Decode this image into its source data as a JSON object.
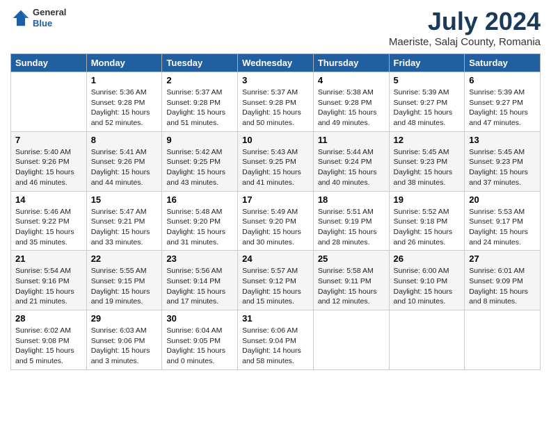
{
  "header": {
    "logo": {
      "line1": "General",
      "line2": "Blue"
    },
    "title": "July 2024",
    "location": "Maeriste, Salaj County, Romania"
  },
  "weekdays": [
    "Sunday",
    "Monday",
    "Tuesday",
    "Wednesday",
    "Thursday",
    "Friday",
    "Saturday"
  ],
  "weeks": [
    [
      {
        "day": "",
        "info": ""
      },
      {
        "day": "1",
        "info": "Sunrise: 5:36 AM\nSunset: 9:28 PM\nDaylight: 15 hours\nand 52 minutes."
      },
      {
        "day": "2",
        "info": "Sunrise: 5:37 AM\nSunset: 9:28 PM\nDaylight: 15 hours\nand 51 minutes."
      },
      {
        "day": "3",
        "info": "Sunrise: 5:37 AM\nSunset: 9:28 PM\nDaylight: 15 hours\nand 50 minutes."
      },
      {
        "day": "4",
        "info": "Sunrise: 5:38 AM\nSunset: 9:28 PM\nDaylight: 15 hours\nand 49 minutes."
      },
      {
        "day": "5",
        "info": "Sunrise: 5:39 AM\nSunset: 9:27 PM\nDaylight: 15 hours\nand 48 minutes."
      },
      {
        "day": "6",
        "info": "Sunrise: 5:39 AM\nSunset: 9:27 PM\nDaylight: 15 hours\nand 47 minutes."
      }
    ],
    [
      {
        "day": "7",
        "info": "Sunrise: 5:40 AM\nSunset: 9:26 PM\nDaylight: 15 hours\nand 46 minutes."
      },
      {
        "day": "8",
        "info": "Sunrise: 5:41 AM\nSunset: 9:26 PM\nDaylight: 15 hours\nand 44 minutes."
      },
      {
        "day": "9",
        "info": "Sunrise: 5:42 AM\nSunset: 9:25 PM\nDaylight: 15 hours\nand 43 minutes."
      },
      {
        "day": "10",
        "info": "Sunrise: 5:43 AM\nSunset: 9:25 PM\nDaylight: 15 hours\nand 41 minutes."
      },
      {
        "day": "11",
        "info": "Sunrise: 5:44 AM\nSunset: 9:24 PM\nDaylight: 15 hours\nand 40 minutes."
      },
      {
        "day": "12",
        "info": "Sunrise: 5:45 AM\nSunset: 9:23 PM\nDaylight: 15 hours\nand 38 minutes."
      },
      {
        "day": "13",
        "info": "Sunrise: 5:45 AM\nSunset: 9:23 PM\nDaylight: 15 hours\nand 37 minutes."
      }
    ],
    [
      {
        "day": "14",
        "info": "Sunrise: 5:46 AM\nSunset: 9:22 PM\nDaylight: 15 hours\nand 35 minutes."
      },
      {
        "day": "15",
        "info": "Sunrise: 5:47 AM\nSunset: 9:21 PM\nDaylight: 15 hours\nand 33 minutes."
      },
      {
        "day": "16",
        "info": "Sunrise: 5:48 AM\nSunset: 9:20 PM\nDaylight: 15 hours\nand 31 minutes."
      },
      {
        "day": "17",
        "info": "Sunrise: 5:49 AM\nSunset: 9:20 PM\nDaylight: 15 hours\nand 30 minutes."
      },
      {
        "day": "18",
        "info": "Sunrise: 5:51 AM\nSunset: 9:19 PM\nDaylight: 15 hours\nand 28 minutes."
      },
      {
        "day": "19",
        "info": "Sunrise: 5:52 AM\nSunset: 9:18 PM\nDaylight: 15 hours\nand 26 minutes."
      },
      {
        "day": "20",
        "info": "Sunrise: 5:53 AM\nSunset: 9:17 PM\nDaylight: 15 hours\nand 24 minutes."
      }
    ],
    [
      {
        "day": "21",
        "info": "Sunrise: 5:54 AM\nSunset: 9:16 PM\nDaylight: 15 hours\nand 21 minutes."
      },
      {
        "day": "22",
        "info": "Sunrise: 5:55 AM\nSunset: 9:15 PM\nDaylight: 15 hours\nand 19 minutes."
      },
      {
        "day": "23",
        "info": "Sunrise: 5:56 AM\nSunset: 9:14 PM\nDaylight: 15 hours\nand 17 minutes."
      },
      {
        "day": "24",
        "info": "Sunrise: 5:57 AM\nSunset: 9:12 PM\nDaylight: 15 hours\nand 15 minutes."
      },
      {
        "day": "25",
        "info": "Sunrise: 5:58 AM\nSunset: 9:11 PM\nDaylight: 15 hours\nand 12 minutes."
      },
      {
        "day": "26",
        "info": "Sunrise: 6:00 AM\nSunset: 9:10 PM\nDaylight: 15 hours\nand 10 minutes."
      },
      {
        "day": "27",
        "info": "Sunrise: 6:01 AM\nSunset: 9:09 PM\nDaylight: 15 hours\nand 8 minutes."
      }
    ],
    [
      {
        "day": "28",
        "info": "Sunrise: 6:02 AM\nSunset: 9:08 PM\nDaylight: 15 hours\nand 5 minutes."
      },
      {
        "day": "29",
        "info": "Sunrise: 6:03 AM\nSunset: 9:06 PM\nDaylight: 15 hours\nand 3 minutes."
      },
      {
        "day": "30",
        "info": "Sunrise: 6:04 AM\nSunset: 9:05 PM\nDaylight: 15 hours\nand 0 minutes."
      },
      {
        "day": "31",
        "info": "Sunrise: 6:06 AM\nSunset: 9:04 PM\nDaylight: 14 hours\nand 58 minutes."
      },
      {
        "day": "",
        "info": ""
      },
      {
        "day": "",
        "info": ""
      },
      {
        "day": "",
        "info": ""
      }
    ]
  ]
}
